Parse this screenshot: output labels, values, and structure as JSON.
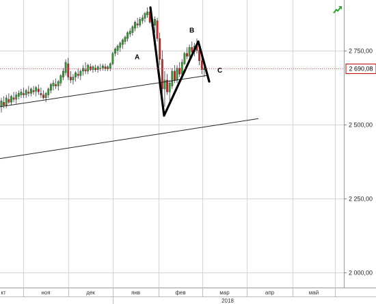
{
  "chart_data": {
    "type": "candlestick",
    "title": "",
    "xlabel": "",
    "ylabel": "",
    "ylim": [
      1950,
      2920
    ],
    "y_ticks": [
      {
        "value": 2750,
        "label": "2 750,00"
      },
      {
        "value": 2500,
        "label": "2 500,00"
      },
      {
        "value": 2250,
        "label": "2 250,00"
      },
      {
        "value": 2000,
        "label": "2 000,00"
      }
    ],
    "month_labels": [
      "кт",
      "ноя",
      "дек",
      "янв",
      "фев",
      "мар",
      "апр",
      "май"
    ],
    "year_label": "2018",
    "current_price": {
      "value": 2690.08,
      "label": "2 690,08"
    },
    "grid": true,
    "trend_icon": "trend-up-arrow-icon",
    "colors": {
      "up": "#2e9e2e",
      "down": "#d62020",
      "price_line": "#e05050",
      "price_box_border": "#cc0000",
      "grid": "#d4d4d4",
      "trend_line": "#222222",
      "pattern": "#000000",
      "icon": "#2aa52a"
    },
    "candles": [
      [
        2560,
        2590,
        2540,
        2580
      ],
      [
        2575,
        2595,
        2555,
        2565
      ],
      [
        2565,
        2600,
        2555,
        2590
      ],
      [
        2585,
        2605,
        2570,
        2575
      ],
      [
        2575,
        2600,
        2565,
        2595
      ],
      [
        2590,
        2610,
        2575,
        2585
      ],
      [
        2585,
        2610,
        2570,
        2600
      ],
      [
        2595,
        2615,
        2585,
        2605
      ],
      [
        2600,
        2620,
        2590,
        2610
      ],
      [
        2605,
        2625,
        2590,
        2600
      ],
      [
        2600,
        2620,
        2590,
        2615
      ],
      [
        2610,
        2630,
        2595,
        2605
      ],
      [
        2605,
        2625,
        2595,
        2620
      ],
      [
        2615,
        2630,
        2600,
        2610
      ],
      [
        2612,
        2630,
        2595,
        2625
      ],
      [
        2620,
        2635,
        2600,
        2610
      ],
      [
        2605,
        2625,
        2590,
        2600
      ],
      [
        2600,
        2615,
        2585,
        2590
      ],
      [
        2590,
        2610,
        2575,
        2605
      ],
      [
        2600,
        2625,
        2590,
        2620
      ],
      [
        2615,
        2640,
        2605,
        2635
      ],
      [
        2630,
        2650,
        2615,
        2640
      ],
      [
        2635,
        2655,
        2620,
        2630
      ],
      [
        2630,
        2650,
        2615,
        2645
      ],
      [
        2640,
        2670,
        2630,
        2665
      ],
      [
        2660,
        2690,
        2650,
        2680
      ],
      [
        2675,
        2720,
        2665,
        2710
      ],
      [
        2705,
        2725,
        2650,
        2660
      ],
      [
        2660,
        2680,
        2640,
        2650
      ],
      [
        2650,
        2670,
        2635,
        2660
      ],
      [
        2660,
        2680,
        2645,
        2675
      ],
      [
        2670,
        2690,
        2655,
        2665
      ],
      [
        2665,
        2685,
        2650,
        2680
      ],
      [
        2680,
        2700,
        2665,
        2690
      ],
      [
        2685,
        2710,
        2670,
        2680
      ],
      [
        2680,
        2705,
        2670,
        2700
      ],
      [
        2695,
        2705,
        2680,
        2685
      ],
      [
        2685,
        2700,
        2675,
        2695
      ],
      [
        2690,
        2702,
        2678,
        2685
      ],
      [
        2685,
        2700,
        2675,
        2695
      ],
      [
        2690,
        2705,
        2680,
        2690
      ],
      [
        2690,
        2705,
        2682,
        2698
      ],
      [
        2695,
        2705,
        2680,
        2688
      ],
      [
        2688,
        2700,
        2680,
        2695
      ],
      [
        2690,
        2710,
        2680,
        2705
      ],
      [
        2705,
        2745,
        2700,
        2740
      ],
      [
        2740,
        2760,
        2730,
        2755
      ],
      [
        2750,
        2770,
        2735,
        2765
      ],
      [
        2760,
        2780,
        2745,
        2775
      ],
      [
        2770,
        2790,
        2755,
        2785
      ],
      [
        2780,
        2800,
        2770,
        2795
      ],
      [
        2790,
        2815,
        2780,
        2810
      ],
      [
        2805,
        2825,
        2795,
        2815
      ],
      [
        2810,
        2835,
        2800,
        2830
      ],
      [
        2825,
        2850,
        2815,
        2845
      ],
      [
        2840,
        2860,
        2825,
        2835
      ],
      [
        2835,
        2862,
        2828,
        2855
      ],
      [
        2850,
        2870,
        2840,
        2860
      ],
      [
        2858,
        2880,
        2845,
        2875
      ],
      [
        2870,
        2895,
        2860,
        2880
      ],
      [
        2880,
        2890,
        2840,
        2845
      ],
      [
        2845,
        2860,
        2820,
        2830
      ],
      [
        2835,
        2865,
        2810,
        2855
      ],
      [
        2850,
        2860,
        2780,
        2790
      ],
      [
        2790,
        2810,
        2700,
        2720
      ],
      [
        2720,
        2750,
        2590,
        2620
      ],
      [
        2620,
        2680,
        2560,
        2650
      ],
      [
        2650,
        2670,
        2600,
        2610
      ],
      [
        2610,
        2650,
        2580,
        2640
      ],
      [
        2630,
        2690,
        2620,
        2680
      ],
      [
        2680,
        2700,
        2640,
        2650
      ],
      [
        2650,
        2700,
        2640,
        2690
      ],
      [
        2690,
        2710,
        2660,
        2670
      ],
      [
        2670,
        2720,
        2660,
        2710
      ],
      [
        2705,
        2745,
        2700,
        2740
      ],
      [
        2740,
        2760,
        2720,
        2730
      ],
      [
        2730,
        2770,
        2720,
        2760
      ],
      [
        2760,
        2780,
        2735,
        2745
      ],
      [
        2745,
        2775,
        2730,
        2765
      ],
      [
        2765,
        2790,
        2740,
        2750
      ],
      [
        2750,
        2770,
        2700,
        2715
      ],
      [
        2715,
        2735,
        2670,
        2685
      ],
      [
        2685,
        2700,
        2660,
        2690
      ]
    ],
    "trend_lines": [
      {
        "x1": 0,
        "y1": 2560,
        "x2": 302,
        "y2": 2665
      },
      {
        "x1": 0,
        "y1": 2385,
        "x2": 378,
        "y2": 2520
      }
    ],
    "pattern_path": [
      [
        220,
        2895
      ],
      [
        240,
        2530
      ],
      [
        290,
        2780
      ],
      [
        306,
        2645
      ]
    ],
    "annotations": [
      {
        "text": "A",
        "x": 197,
        "y": 2720
      },
      {
        "text": "B",
        "x": 277,
        "y": 2810
      },
      {
        "text": "C",
        "x": 318,
        "y": 2675
      }
    ]
  }
}
